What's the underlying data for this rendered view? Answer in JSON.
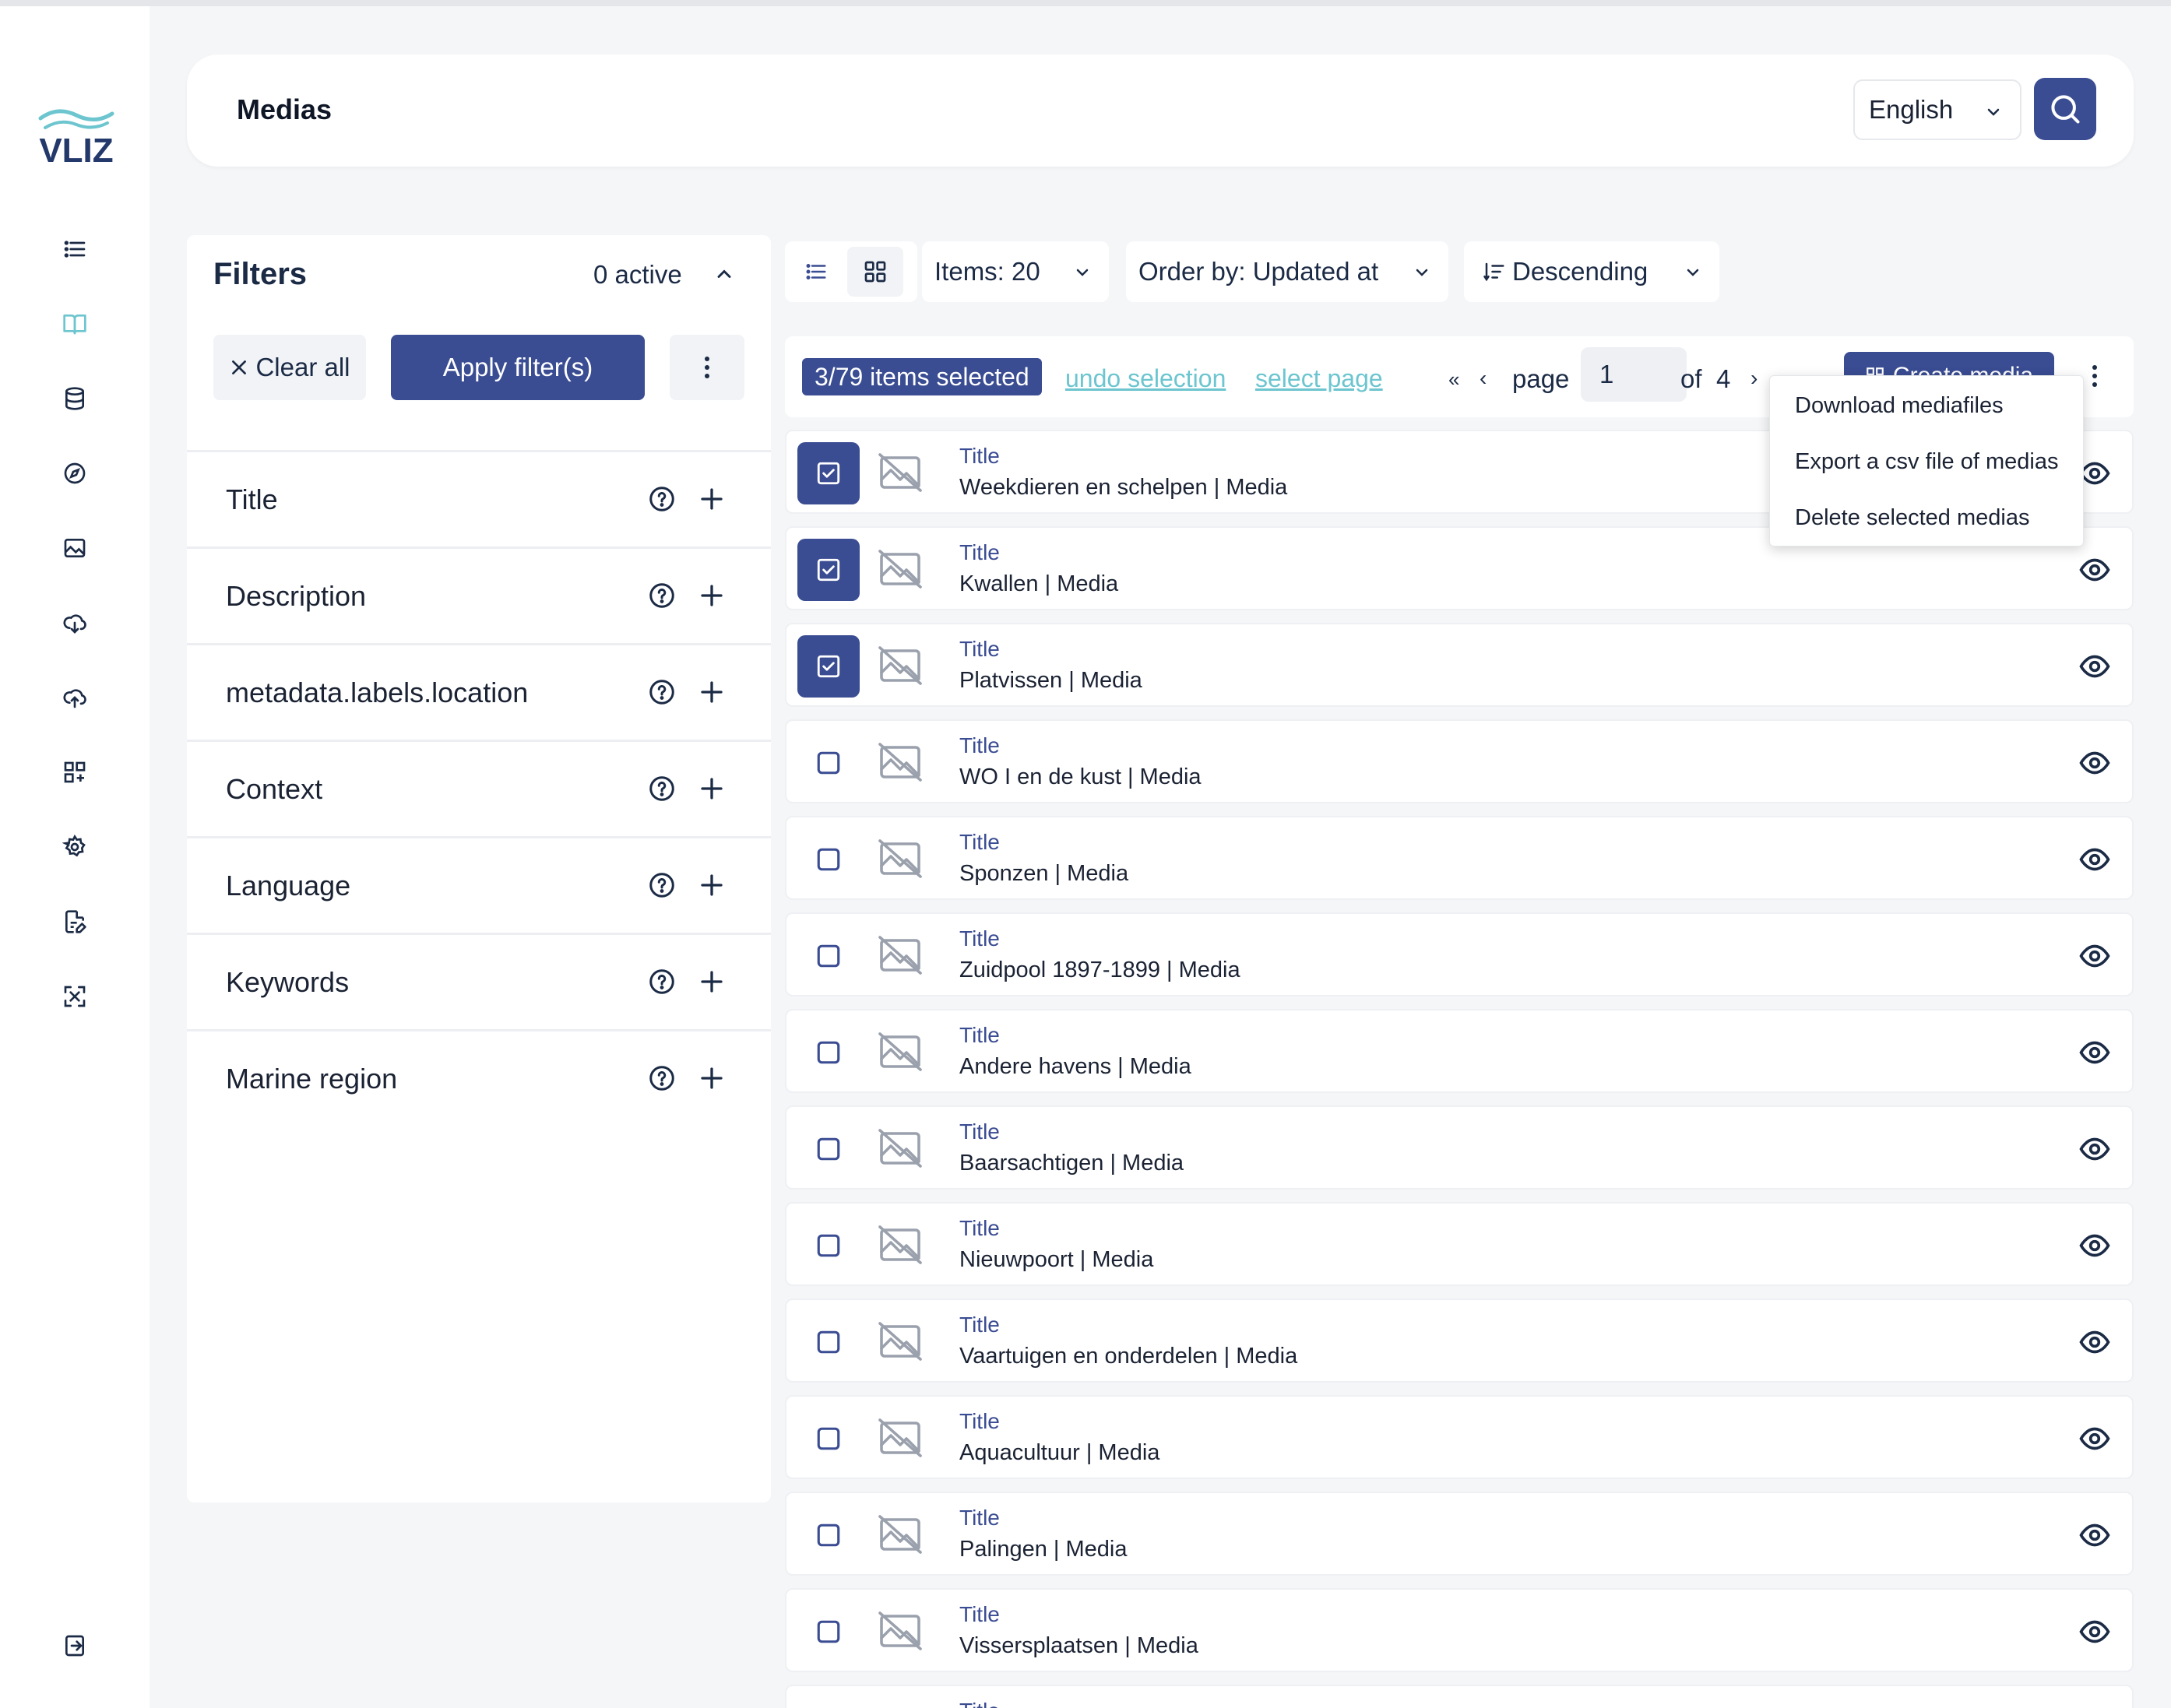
{
  "brand": {
    "logo_text": "VLIZ",
    "color": "#23386b"
  },
  "colors": {
    "primary": "#3a4c92",
    "link": "#6cc5cf",
    "text": "#1a2233",
    "bg": "#f5f6f8"
  },
  "sidebar": {
    "icons": [
      "list-icon",
      "book-icon",
      "database-icon",
      "compass-icon",
      "image-icon",
      "cloud-download-icon",
      "cloud-upload-icon",
      "grid-plus-icon",
      "settings-icon",
      "file-edit-icon",
      "scan-icon",
      "logout-icon"
    ]
  },
  "header": {
    "title": "Medias",
    "language": "English"
  },
  "filters": {
    "title": "Filters",
    "active": "0 active",
    "clear_all": "Clear all",
    "apply": "Apply filter(s)",
    "fields": [
      "Title",
      "Description",
      "metadata.labels.location",
      "Context",
      "Language",
      "Keywords",
      "Marine region"
    ]
  },
  "toolbar": {
    "items": "Items: 20",
    "order_by": "Order by: Updated at",
    "direction": "Descending"
  },
  "selection": {
    "count": "3/79 items selected",
    "undo": "undo selection",
    "select_page": "select page",
    "page_label": "page",
    "page_value": "1",
    "of_label": "of",
    "total_pages": "4",
    "create": "Create media"
  },
  "menu": {
    "items": [
      "Download mediafiles",
      "Export a csv file of medias",
      "Delete selected medias"
    ]
  },
  "rows": {
    "label": "Title",
    "items": [
      {
        "value": "Weekdieren en schelpen | Media",
        "selected": true
      },
      {
        "value": "Kwallen | Media",
        "selected": true
      },
      {
        "value": "Platvissen | Media",
        "selected": true
      },
      {
        "value": "WO I en de kust | Media",
        "selected": false
      },
      {
        "value": "Sponzen | Media",
        "selected": false
      },
      {
        "value": "Zuidpool 1897-1899 | Media",
        "selected": false
      },
      {
        "value": "Andere havens | Media",
        "selected": false
      },
      {
        "value": "Baarsachtigen | Media",
        "selected": false
      },
      {
        "value": "Nieuwpoort | Media",
        "selected": false
      },
      {
        "value": "Vaartuigen en onderdelen | Media",
        "selected": false
      },
      {
        "value": "Aquacultuur | Media",
        "selected": false
      },
      {
        "value": "Palingen | Media",
        "selected": false
      },
      {
        "value": "Vissersplaatsen | Media",
        "selected": false
      }
    ]
  }
}
